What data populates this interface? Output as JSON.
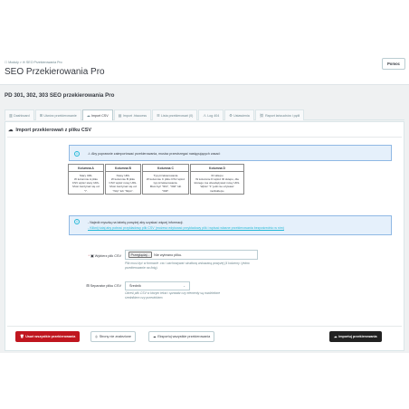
{
  "header": {
    "breadcrumb": "☐ Moduły  >  ✉ SEO Przekierowania Pro",
    "title": "SEO Przekierowania Pro",
    "help_label": "Pomoc"
  },
  "module": {
    "title": "PD 301, 302, 303 SEO przekierowania Pro"
  },
  "tabs": [
    {
      "label": "Dashboard",
      "icon": "bar-chart-icon"
    },
    {
      "label": "Utwórz przekierowanie",
      "icon": "plus-square-icon"
    },
    {
      "label": "Import CSV",
      "icon": "cloud-upload-icon",
      "active": true
    },
    {
      "label": "Import .htaccess",
      "icon": "file-icon"
    },
    {
      "label": "Lista przekierowań (0)",
      "icon": "list-icon"
    },
    {
      "label": "Log 404",
      "icon": "warning-icon"
    },
    {
      "label": "Ustawienia",
      "icon": "gears-icon"
    },
    {
      "label": "Raport łańcuchów i pętli",
      "icon": "link-icon"
    }
  ],
  "panel": {
    "heading": "Import przekierowań z pliku CSV"
  },
  "alert_info": {
    "text": "⚠ Aby poprawnie zaimportować przekierowania, musisz przestrzegać następujących zasad:"
  },
  "columns": [
    {
      "header": "Kolumna A",
      "body": [
        "Stary URL",
        "W kolumnie A pliku",
        "CSV wpisz stary URL.",
        "Musi zaczynać się od",
        "\"/\"."
      ]
    },
    {
      "header": "Kolumna B",
      "body": [
        "Nowy URL",
        "W kolumnie B pliku",
        "CSV wpisz nowy URL.",
        "Musi zaczynać się od",
        "\"http\" lub \"https\"."
      ]
    },
    {
      "header": "Kolumna C",
      "body": [
        "Typ przekierowania",
        "W kolumnie C pliku CSV wpisz",
        "typ przekierowania.",
        "Musi być \"301\", \"302\" lub",
        "\"303\"."
      ]
    },
    {
      "header": "Kolumna D",
      "body": [
        "ID sklepu",
        "W kolumnie D wpisz ID sklepu, dla",
        "którego ma obowiązywać nowy URL.",
        "Wpisz \"1\" jeśli nie używasz",
        "multisklepu."
      ]
    }
  ],
  "alert_tips": {
    "line1": "- Najedź myszką na tabelę powyżej aby uzyskać więcej informacji.",
    "line2": "- Kliknij tutaj aby pobrać przykładowy plik CSV (możesz edytować przykładowy plik i wpisać własne przekierowania bezpośrednio w nim)"
  },
  "form": {
    "file_label": "Wybierz plik CSV",
    "file_button": "Przeglądaj...",
    "file_status": "Nie wybrano pliku.",
    "file_help": "Plik musi być w formacie .csv i zachowywać strukturę wskazaną powyżej (4 kolumny i jedno przekierowanie na linię).",
    "separator_label": "Separator pliku CSV",
    "separator_value": "Średnik",
    "separator_help": "Określ plik CSV w którym tekst i sprawdź czy elementy są rozdzielone średnikiem czy przecinkiem."
  },
  "footer": {
    "delete_label": "Usuń wszystkie przekierowania",
    "not_found_label": "Strony nie znalezione",
    "export_label": "Eksportuj wszystkie przekierowania",
    "import_label": "Importuj przekierowania"
  },
  "colors": {
    "accent": "#25b9d7",
    "danger": "#c0161f",
    "dark": "#222222"
  }
}
